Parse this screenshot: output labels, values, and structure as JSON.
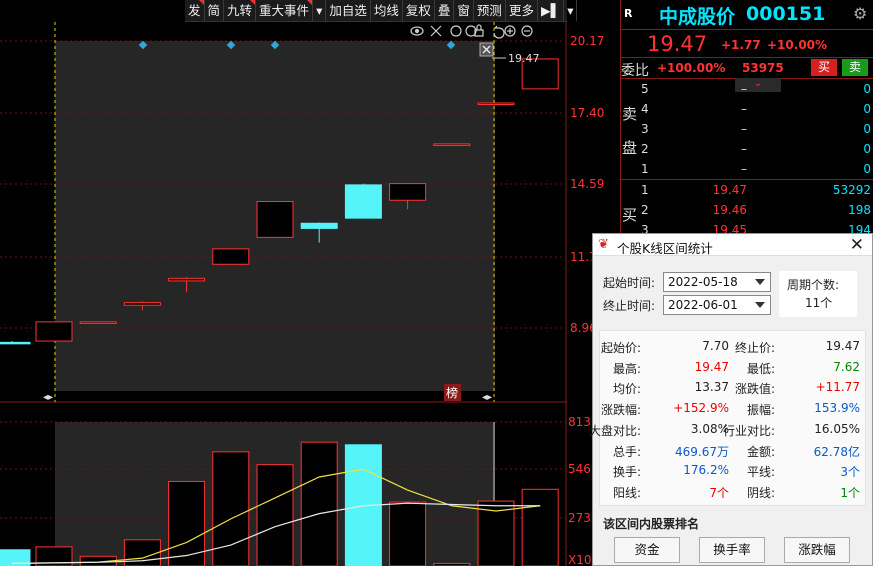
{
  "toolbar": {
    "items": [
      "发",
      "简",
      "九转",
      "重大事件",
      "▾",
      "加自选",
      "均线",
      "复权",
      "叠",
      "窗",
      "预测",
      "更多",
      "▶▌",
      "▾"
    ]
  },
  "chart_data": {
    "type": "candlestick",
    "price_axis_labels": [
      "20.17",
      "17.40",
      "14.59",
      "11.7",
      "8.96"
    ],
    "volume_axis_labels": [
      "813",
      "546",
      "273",
      "X10"
    ],
    "last_price_label": "19.47",
    "bang_label": "榜",
    "candles": [
      {
        "open": 8.4,
        "close": 8.4,
        "high": 8.45,
        "low": 8.35,
        "color": "cyan"
      },
      {
        "open": 8.45,
        "close": 9.2,
        "high": 9.2,
        "low": 8.45,
        "color": "red"
      },
      {
        "open": 9.15,
        "close": 9.2,
        "high": 9.2,
        "low": 9.15,
        "color": "red"
      },
      {
        "open": 9.85,
        "close": 9.95,
        "high": 10.0,
        "low": 9.65,
        "color": "red"
      },
      {
        "open": 10.8,
        "close": 10.9,
        "high": 10.95,
        "low": 10.35,
        "color": "red"
      },
      {
        "open": 11.45,
        "close": 12.05,
        "high": 12.05,
        "low": 11.45,
        "color": "red"
      },
      {
        "open": 12.5,
        "close": 13.9,
        "high": 13.9,
        "low": 12.5,
        "color": "red"
      },
      {
        "open": 12.85,
        "close": 13.05,
        "high": 13.08,
        "low": 12.3,
        "color": "cyan"
      },
      {
        "open": 13.25,
        "close": 14.55,
        "high": 14.6,
        "low": 13.25,
        "color": "cyan"
      },
      {
        "open": 13.95,
        "close": 14.6,
        "high": 14.6,
        "low": 13.6,
        "color": "red"
      },
      {
        "open": 16.1,
        "close": 16.15,
        "high": 16.15,
        "low": 16.1,
        "color": "red"
      },
      {
        "open": 17.7,
        "close": 17.75,
        "high": 17.75,
        "low": 17.7,
        "color": "red"
      },
      {
        "open": 18.3,
        "close": 19.47,
        "high": 19.47,
        "low": 18.3,
        "color": "red"
      }
    ],
    "volume": [
      {
        "value": 62,
        "color": "cyan"
      },
      {
        "value": 73,
        "color": "red"
      },
      {
        "value": 37,
        "color": "red"
      },
      {
        "value": 100,
        "color": "red"
      },
      {
        "value": 323,
        "color": "red"
      },
      {
        "value": 436,
        "color": "red"
      },
      {
        "value": 387,
        "color": "red"
      },
      {
        "value": 473,
        "color": "red"
      },
      {
        "value": 463,
        "color": "cyan"
      },
      {
        "value": 244,
        "color": "red"
      },
      {
        "value": 10,
        "color": "red"
      },
      {
        "value": 248,
        "color": "red"
      },
      {
        "value": 293,
        "color": "red"
      }
    ],
    "ma_yellow": [
      10,
      12,
      15,
      30,
      90,
      180,
      260,
      340,
      370,
      290,
      230,
      210,
      230
    ],
    "ma_white": [
      10,
      12,
      14,
      20,
      40,
      80,
      150,
      200,
      230,
      240,
      235,
      230,
      230
    ],
    "volume_max": 550
  },
  "quote": {
    "r": "R",
    "name": "中成股价",
    "code": "000151",
    "price": "19.47",
    "change": "+1.77",
    "pct": "+10.00%",
    "weibi_label": "委比",
    "weibi": "+100.00%",
    "weicha": "53975",
    "buy": "买",
    "sell": "卖",
    "sell_label": [
      "卖",
      "盘"
    ],
    "buy_label": [
      "买"
    ],
    "sell_rows": [
      {
        "n": "5",
        "p": "–",
        "v": "0"
      },
      {
        "n": "4",
        "p": "–",
        "v": "0"
      },
      {
        "n": "3",
        "p": "–",
        "v": "0"
      },
      {
        "n": "2",
        "p": "–",
        "v": "0"
      },
      {
        "n": "1",
        "p": "–",
        "v": "0"
      }
    ],
    "buy_rows": [
      {
        "n": "1",
        "p": "19.47",
        "v": "53292"
      },
      {
        "n": "2",
        "p": "19.46",
        "v": "198"
      },
      {
        "n": "3",
        "p": "19.45",
        "v": "194"
      }
    ]
  },
  "dialog": {
    "title": "个股K线区间统计",
    "start_label": "起始时间:",
    "start": "2022-05-18",
    "end_label": "终止时间:",
    "end": "2022-06-01",
    "period_label": "周期个数:",
    "period": "11个",
    "stats_left": [
      {
        "k": "起始价:",
        "v": "7.70",
        "c": "#222"
      },
      {
        "k": "最高:",
        "v": "19.47",
        "c": "#e00"
      },
      {
        "k": "均价:",
        "v": "13.37",
        "c": "#222"
      },
      {
        "k": "涨跌幅:",
        "v": "+152.9%",
        "c": "#e00"
      },
      {
        "k": "大盘对比:",
        "v": "3.08%",
        "c": "#222"
      },
      {
        "k": "总手:",
        "v": "469.67万",
        "c": "#0a5ac8"
      },
      {
        "k": "换手:",
        "v": "176.2%",
        "c": "#0a5ac8"
      },
      {
        "k": "阳线:",
        "v": "7个",
        "c": "#e00"
      }
    ],
    "stats_right": [
      {
        "k": "终止价:",
        "v": "19.47",
        "c": "#222"
      },
      {
        "k": "最低:",
        "v": "7.62",
        "c": "#080"
      },
      {
        "k": "涨跌值:",
        "v": "+11.77",
        "c": "#e00"
      },
      {
        "k": "振幅:",
        "v": "153.9%",
        "c": "#0a5ac8"
      },
      {
        "k": "行业对比:",
        "v": "16.05%",
        "c": "#222"
      },
      {
        "k": "金额:",
        "v": "62.78亿",
        "c": "#0a5ac8"
      },
      {
        "k": "平线:",
        "v": "3个",
        "c": "#0a5ac8"
      },
      {
        "k": "阴线:",
        "v": "1个",
        "c": "#080"
      }
    ],
    "rank_title": "该区间内股票排名",
    "buttons": [
      "资金",
      "换手率",
      "涨跌幅"
    ]
  }
}
